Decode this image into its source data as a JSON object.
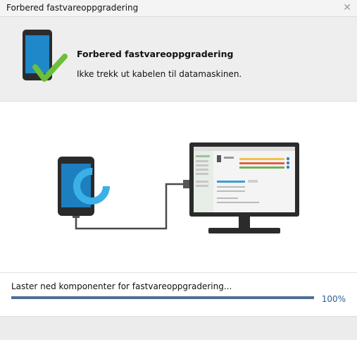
{
  "window": {
    "title": "Forbered fastvareoppgradering",
    "close_icon": "close-icon"
  },
  "header": {
    "icon": "phone-checkmark-icon",
    "title": "Forbered fastvareoppgradering",
    "subtitle": "Ikke trekk ut kabelen til datamaskinen."
  },
  "illustration": {
    "icons": [
      "phone-loading-icon",
      "usb-cable-icon",
      "monitor-icon"
    ]
  },
  "status": {
    "message": "Laster ned komponenter for fastvareoppgradering...",
    "progress_percent": 100,
    "progress_label": "100%"
  },
  "colors": {
    "accent": "#4e6f94",
    "percent_text": "#2e5f9a",
    "check_green": "#6cbf3a",
    "phone_screen": "#1d7fc0",
    "ring": "#3ab1e6"
  }
}
